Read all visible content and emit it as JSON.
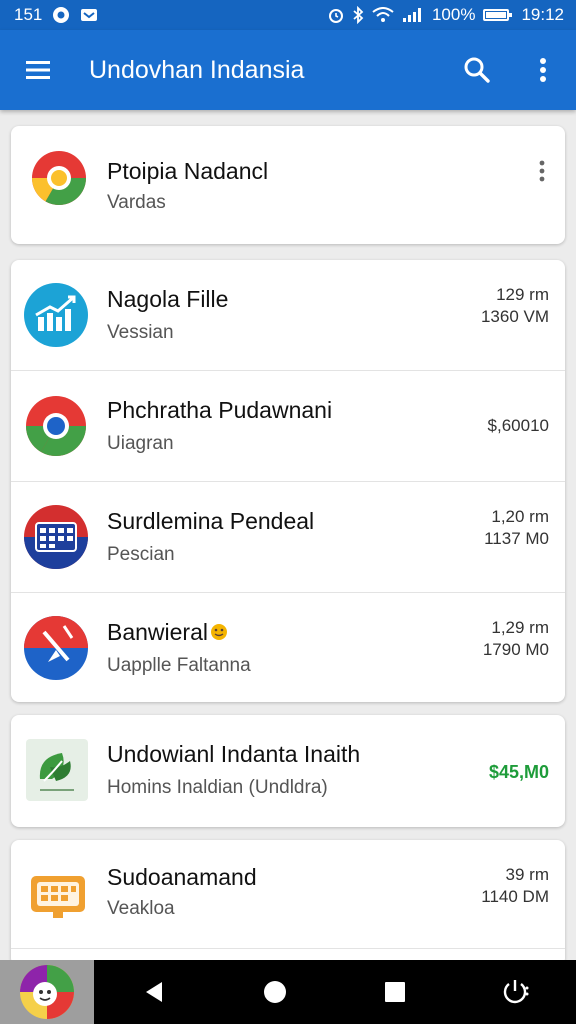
{
  "status_bar": {
    "notification_count": "151",
    "battery": "100%",
    "battery_level": 1.0,
    "time": "19:12"
  },
  "app_bar": {
    "title": "Undovhan Indansia"
  },
  "cards": [
    {
      "items": [
        {
          "title": "Ptoipia Nadancl",
          "subtitle": "Vardas",
          "icon": "chrome-style-icon"
        }
      ]
    },
    {
      "items": [
        {
          "title": "Nagola Fille",
          "subtitle": "Vessian",
          "meta1": "129 rm",
          "meta2": "1360 VM",
          "icon": "chart-icon"
        },
        {
          "title": "Phchratha Pudawnani",
          "subtitle": "Uiagran",
          "meta1": "$,60010",
          "icon": "chrome-style-icon"
        },
        {
          "title": "Surdlemina Pendeal",
          "subtitle": "Pescian",
          "meta1": "1,20 rm",
          "meta2": "1137 M0",
          "icon": "calendar-icon"
        },
        {
          "title": "Banwieral",
          "subtitle": "Uapplle Faltanna",
          "meta1": "1,29 rm",
          "meta2": "1790 M0",
          "icon": "pinwheel-icon"
        }
      ]
    },
    {
      "items": [
        {
          "title": "Undowianl Indanta Inaith",
          "subtitle": "Homins Inaldian (Undldra)",
          "meta1": "$45,M0",
          "icon": "leaf-icon"
        }
      ]
    },
    {
      "items": [
        {
          "title": "Sudoanamand",
          "subtitle": "Veakloa",
          "meta1": "39 rm",
          "meta2": "1140 DM",
          "icon": "keyboard-icon"
        }
      ]
    }
  ],
  "colors": {
    "primary": "#1a6fd0",
    "status_bar": "#1565c0",
    "price_green": "#1e9c3a"
  }
}
